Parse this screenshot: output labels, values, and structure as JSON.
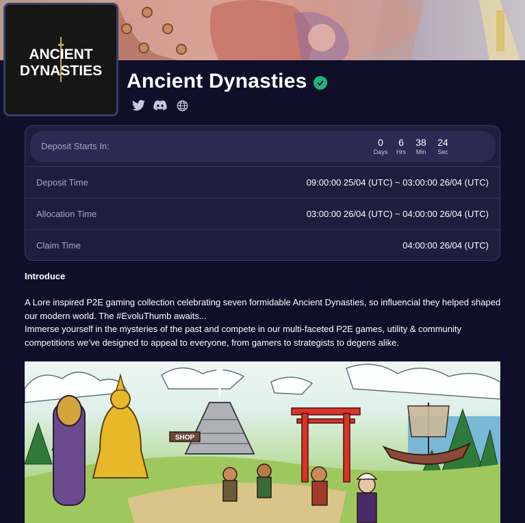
{
  "collection": {
    "name": "Ancient Dynasties",
    "logo_text_line1": "ANCIENT",
    "logo_text_line2": "DYNASTIES",
    "verified": true
  },
  "socials": [
    {
      "icon": "twitter-icon"
    },
    {
      "icon": "discord-icon"
    },
    {
      "icon": "globe-icon"
    }
  ],
  "countdown": {
    "label": "Deposit Starts In:",
    "days": "0",
    "days_label": "Days",
    "hours": "6",
    "hours_label": "Hrs",
    "minutes": "38",
    "minutes_label": "Min",
    "seconds": "24",
    "seconds_label": "Sec"
  },
  "schedule": [
    {
      "label": "Deposit Time",
      "value": "09:00:00 25/04 (UTC) ~ 03:00:00 26/04 (UTC)"
    },
    {
      "label": "Allocation Time",
      "value": "03:00:00 26/04 (UTC) ~ 04:00:00 26/04 (UTC)"
    },
    {
      "label": "Claim Time",
      "value": "04:00:00 26/04 (UTC)"
    }
  ],
  "introduce": {
    "title": "Introduce",
    "paragraph1": "A Lore inspired P2E gaming collection celebrating seven formidable Ancient Dynasties, so influencial they helped shaped our modern world. The #EvoluThumb awaits...",
    "paragraph2": "Immerse yourself in the mysteries of the past and compete in our multi-faceted P2E games, utility & community competitions we’ve designed to appeal to everyone, from gamers to strategists to degens alike."
  },
  "artwork": {
    "shop_sign": "SHOP"
  },
  "colors": {
    "background": "#0f0f2a",
    "card": "#1d1d3e",
    "verified": "#23b27c",
    "muted_text": "#a6a6c2"
  }
}
